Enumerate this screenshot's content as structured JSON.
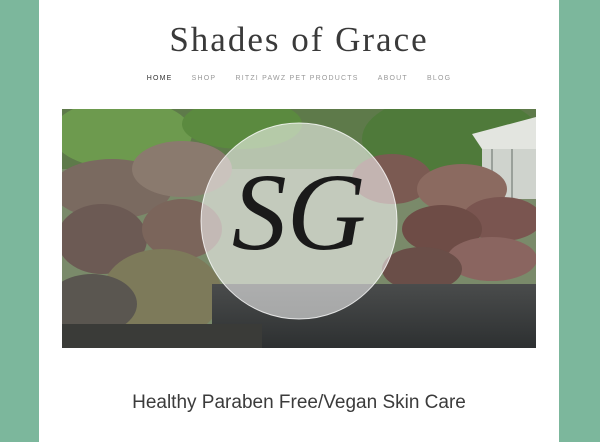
{
  "site": {
    "title": "Shades of Grace"
  },
  "nav": {
    "items": [
      {
        "label": "HOME",
        "active": true
      },
      {
        "label": "SHOP",
        "active": false
      },
      {
        "label": "RITZI PAWZ PET PRODUCTS",
        "active": false
      },
      {
        "label": "ABOUT",
        "active": false
      },
      {
        "label": "BLOG",
        "active": false
      }
    ]
  },
  "hero": {
    "logo_monogram": "SG"
  },
  "tagline": "Healthy Paraben Free/Vegan Skin Care",
  "colors": {
    "background": "#7cb79c",
    "page": "#ffffff",
    "text": "#3a3a3a",
    "nav_inactive": "#999999"
  }
}
